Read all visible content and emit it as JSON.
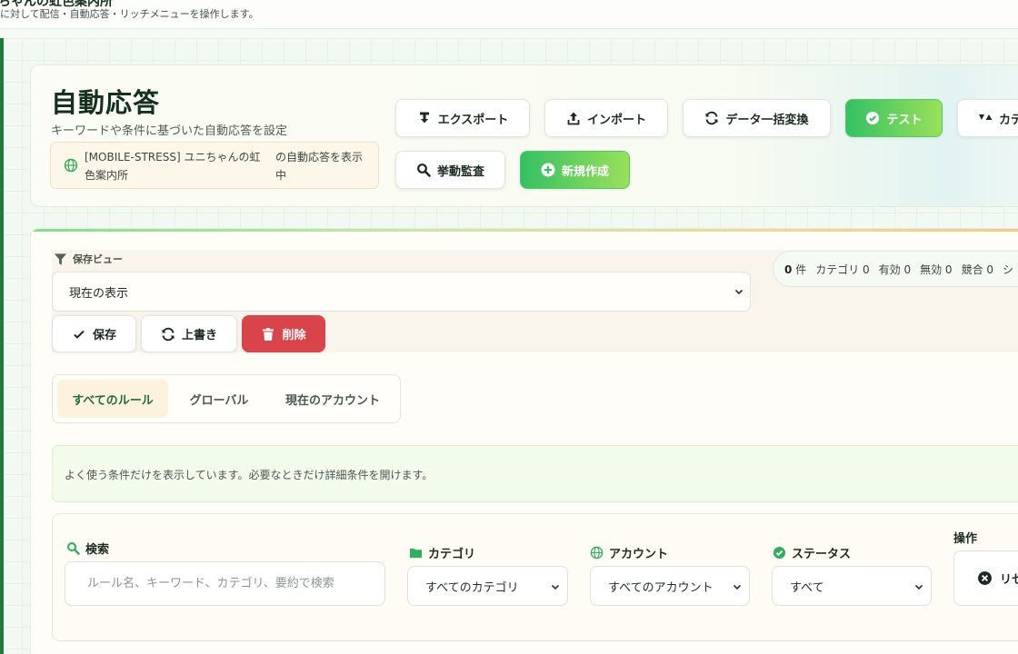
{
  "topbar": {
    "title": "ちゃんの虹色案内所",
    "subtitle": "に対して配信・自動応答・リッチメニューを操作します。"
  },
  "header": {
    "title": "自動応答",
    "subtitle": "キーワードや条件に基づいた自動応答を設定",
    "account_name": "[MOBILE-STRESS] ユニちゃんの虹色案内所",
    "account_suffix": "の自動応答を表示中",
    "buttons": {
      "export": "エクスポート",
      "import": "インポート",
      "bulk_convert": "データ一括変換",
      "test": "テスト",
      "category": "カテゴリ",
      "behavior_audit": "挙動監査",
      "create_new": "新規作成"
    }
  },
  "saved_view": {
    "label": "保存ビュー",
    "selected": "現在の表示",
    "save": "保存",
    "overwrite": "上書き",
    "delete": "削除"
  },
  "stats": {
    "count": "0",
    "count_unit": "件",
    "category": "カテゴリ 0",
    "enabled": "有効 0",
    "disabled": "無効 0",
    "conflict": "競合 0",
    "more": "シ"
  },
  "scope_tabs": [
    "すべてのルール",
    "グローバル",
    "現在のアカウント"
  ],
  "info_text": "よく使う条件だけを表示しています。必要なときだけ詳細条件を開けます。",
  "filters": {
    "search_label": "検索",
    "search_placeholder": "ルール名、キーワード、カテゴリ、要約で検索",
    "category_label": "カテゴリ",
    "category_value": "すべてのカテゴリ",
    "account_label": "アカウント",
    "account_value": "すべてのアカウント",
    "status_label": "ステータス",
    "status_value": "すべて",
    "actions_label": "操作",
    "reset_label": "リセット"
  },
  "colors": {
    "brand_green": "#34c163",
    "danger": "#d9434a",
    "accent_dark": "#1e7a3c"
  }
}
